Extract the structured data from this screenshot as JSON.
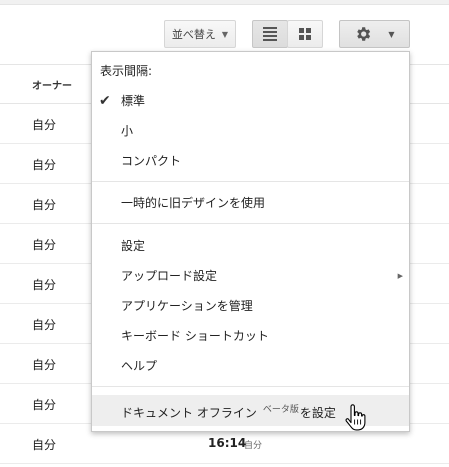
{
  "toolbar": {
    "sort_label": "並べ替え",
    "sort_caret": "▼",
    "view_list_icon": "list-view-icon",
    "view_grid_icon": "grid-view-icon",
    "settings_icon": "gear-icon",
    "settings_caret": "▼"
  },
  "table": {
    "owner_header": "オーナー",
    "rows": [
      {
        "owner": "自分"
      },
      {
        "owner": "自分"
      },
      {
        "owner": "自分"
      },
      {
        "owner": "自分"
      },
      {
        "owner": "自分"
      },
      {
        "owner": "自分"
      },
      {
        "owner": "自分"
      },
      {
        "owner": "自分"
      },
      {
        "owner": "自分",
        "time": "16:14",
        "modified_by": "自分"
      }
    ]
  },
  "menu": {
    "density_heading": "表示間隔:",
    "density_options": [
      {
        "label": "標準",
        "checked": true
      },
      {
        "label": "小",
        "checked": false
      },
      {
        "label": "コンパクト",
        "checked": false
      }
    ],
    "old_design": "一時的に旧デザインを使用",
    "settings": "設定",
    "upload_settings": "アップロード設定",
    "upload_arrow": "▶",
    "manage_apps": "アプリケーションを管理",
    "keyboard_shortcuts": "キーボード ショートカット",
    "help": "ヘルプ",
    "offline_prefix": "ドキュメント オフライン",
    "offline_beta": "ベータ版",
    "offline_suffix": "を設定",
    "check_mark": "✔"
  }
}
